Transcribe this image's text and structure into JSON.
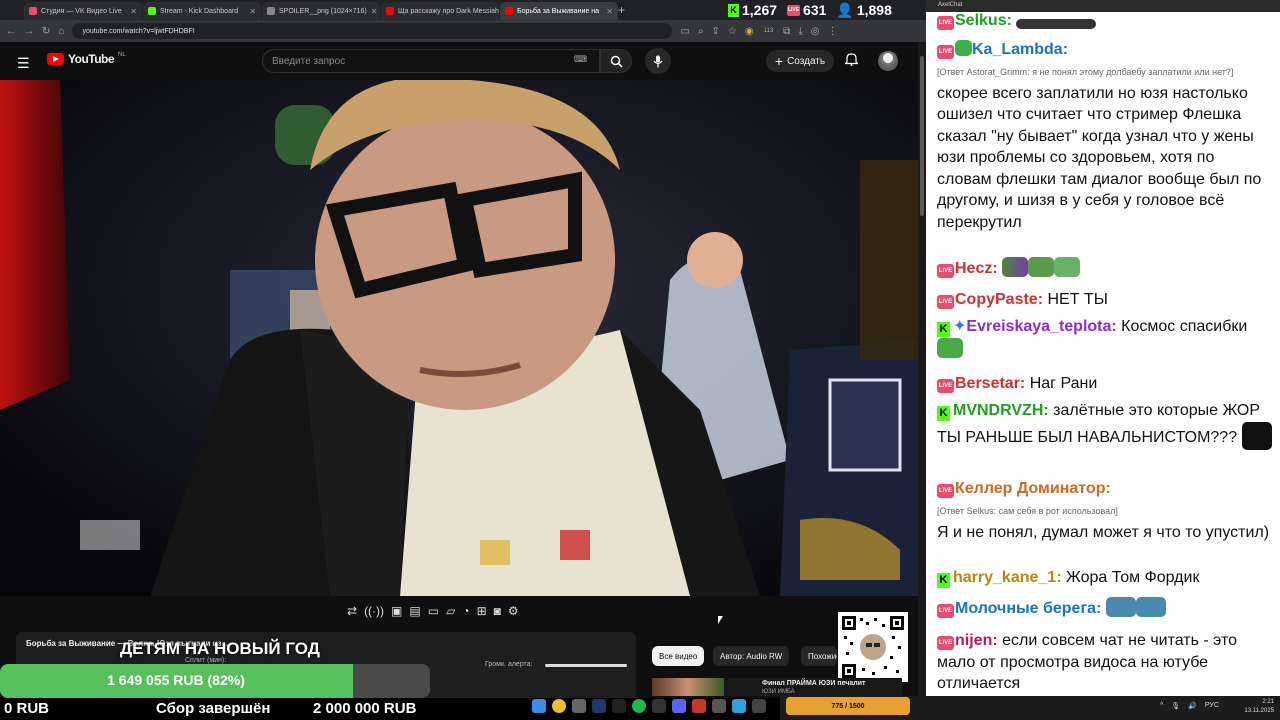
{
  "browser": {
    "tabs": [
      {
        "title": "Студия — VK Видео Live",
        "color": "#ed4b6e"
      },
      {
        "title": "Stream - Kick Dashboard",
        "color": "#53fc18"
      },
      {
        "title": "SPOILER__png (1024×716)",
        "color": "#888888"
      },
      {
        "title": "Ща расскажу про Dark Messiah",
        "color": "#ff0000"
      },
      {
        "title": "Борьба за Выживание на",
        "color": "#ff0000"
      }
    ],
    "new_tab": "+",
    "url": "youtube.com/watch?v=ljwtFDHDBFI",
    "ext_badge": "113"
  },
  "stats": {
    "kick": "1,267",
    "vk": "631",
    "viewers": "1,898"
  },
  "youtube": {
    "brand": "YouTube",
    "region": "NL",
    "search_placeholder": "Введите запрос",
    "create_label": "Создать",
    "chips": [
      "Все видео",
      "Автор: Audio RW",
      "Похожие"
    ],
    "next_video": {
      "title": "Финал ПРАЙМА ЮЗИ печалит",
      "channel": "ЮЗИ ИМБА"
    }
  },
  "stream_panel": {
    "title": "Борьба за Выживание — Волна. Юзя выгнали из...",
    "split_label": "Сплит (мин):",
    "alert_label": "Громк. алерта:",
    "banner": "ДЕТЯМ НА НОВЫЙ ГОД"
  },
  "donation": {
    "current": "1 649 055 RUB (82%)",
    "progress": 0.82,
    "left": "0 RUB",
    "status": "Сбор завершён",
    "goal": "2 000 000 RUB"
  },
  "chat": {
    "window_title": "AxelChat",
    "messages": [
      {
        "source": "vk",
        "nick": "Selkus:",
        "color": "#20a020",
        "text": ""
      },
      {
        "source": "vk",
        "nick": "Ka_Lambda:",
        "color": "#1a73c8",
        "reply": "[Ответ Astorat_Grimm: я не понял этому долбаебу заплатили или нет?]",
        "text": "скорее всего заплатили но юзя настолько ошизел что считает что стример Флешка сказал \"ну бывает\" когда узнал что у жены юзи проблемы со здоровьем, хотя по словам флешки там диалог вообще был по другому, и шизя в у себя у головое всё перекрутил"
      },
      {
        "source": "vk",
        "nick": "Hecz:",
        "color": "#d03030",
        "text": ""
      },
      {
        "source": "vk",
        "nick": "CopyPaste:",
        "color": "#d03030",
        "text": "НЕТ ТЫ"
      },
      {
        "source": "kick",
        "nick": "Evreiskaya_teplota:",
        "color": "#8a2be2",
        "text": "Космос спасибки"
      },
      {
        "source": "vk",
        "nick": "Bersetar:",
        "color": "#d03030",
        "text": "Наг Рани"
      },
      {
        "source": "kick",
        "nick": "MVNDRVZH:",
        "color": "#20a020",
        "text": "залётные это которые ЖОР ТЫ РАНЬШЕ БЫЛ НАВАЛЬНИСТОМ???"
      },
      {
        "source": "vk",
        "nick": "Келлер Доминатор:",
        "color": "#d2691e",
        "reply": "[Ответ Selkus: сам себя в рот использовал]",
        "text": "Я и не понял, думал может я что то упустил)"
      },
      {
        "source": "kick",
        "nick": "harry_kane_1:",
        "color": "#b8860b",
        "text": "Жора Том Фордик"
      },
      {
        "source": "vk",
        "nick": "Молочные берега:",
        "color": "#1a73c8",
        "text": ""
      },
      {
        "source": "vk",
        "nick": "nijen:",
        "color": "#c2185b",
        "text": "если совсем чат не читать - это мало от просмотра видоса на ютубе отличается"
      }
    ]
  },
  "taskbar": {
    "lang": "РУС",
    "time": "2:21",
    "date": "13.11.2025",
    "widget": "775 / 1500"
  },
  "icons": [
    "menu-icon",
    "search-icon",
    "mic-icon",
    "bell-icon",
    "plus-icon",
    "repeat-icon",
    "broadcast-icon",
    "camera-icon",
    "settings-icon",
    "qr-code"
  ]
}
